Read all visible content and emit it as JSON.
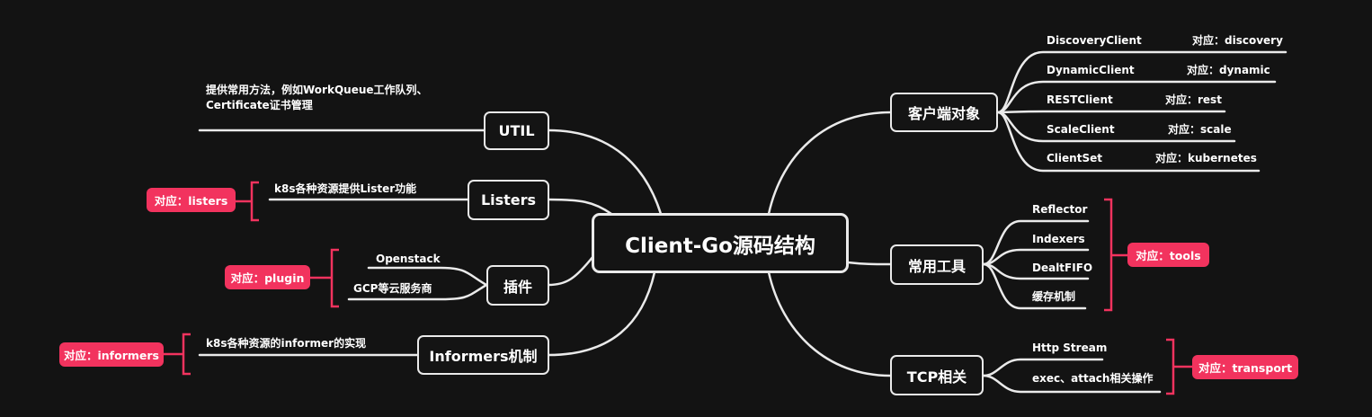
{
  "central": "Client-Go源码结构",
  "left_branches": {
    "util": {
      "label": "UTIL",
      "note_line1": "提供常用方法，例如WorkQueue工作队列、",
      "note_line2": "Certificate证书管理"
    },
    "listers": {
      "label": "Listers",
      "note": "k8s各种资源提供Lister功能",
      "tag": "对应：listers"
    },
    "plugins": {
      "label": "插件",
      "children": [
        "Openstack",
        "GCP等云服务商"
      ],
      "tag": "对应：plugin"
    },
    "informers": {
      "label": "Informers机制",
      "note": "k8s各种资源的informer的实现",
      "tag": "对应：informers"
    }
  },
  "right_branches": {
    "clients": {
      "label": "客户端对象",
      "children": [
        {
          "name": "DiscoveryClient",
          "tag": "对应：discovery"
        },
        {
          "name": "DynamicClient",
          "tag": "对应：dynamic"
        },
        {
          "name": "RESTClient",
          "tag": "对应：rest"
        },
        {
          "name": "ScaleClient",
          "tag": "对应：scale"
        },
        {
          "name": "ClientSet",
          "tag": "对应：kubernetes"
        }
      ]
    },
    "tools": {
      "label": "常用工具",
      "children": [
        "Reflector",
        "Indexers",
        "DealtFIFO",
        "缓存机制"
      ],
      "tag": "对应：tools"
    },
    "tcp": {
      "label": "TCP相关",
      "children": [
        "Http Stream",
        "exec、attach相关操作"
      ],
      "tag": "对应：transport"
    }
  },
  "colors": {
    "background": "#131313",
    "line": "#eaeaea",
    "tag": "#f2335e",
    "bracket": "#f2335e"
  }
}
